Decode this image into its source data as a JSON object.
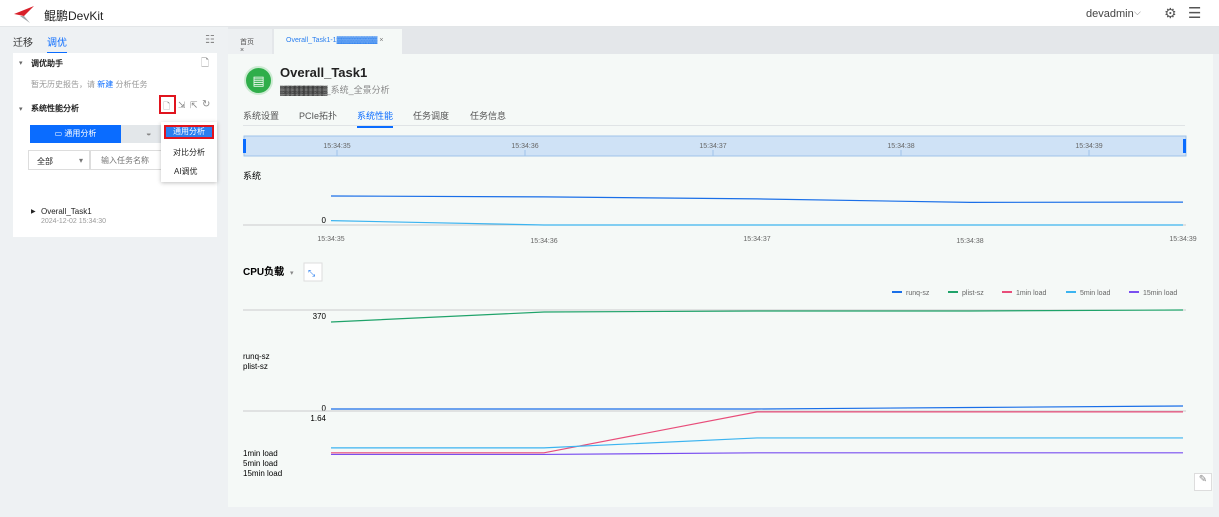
{
  "app": {
    "title": "鲲鹏DevKit",
    "user": "devadmin"
  },
  "left": {
    "tabs": [
      {
        "label": "迁移",
        "active": false
      },
      {
        "label": "调优",
        "active": true
      }
    ],
    "assistant": {
      "title": "调优助手",
      "empty_prefix": "暂无历史报告，请",
      "empty_link": "新建",
      "empty_suffix": "分析任务"
    },
    "perf": {
      "title": "系统性能分析",
      "mode_button": "通用分析",
      "filter_select": "全部",
      "search_placeholder": "输入任务名称",
      "tasks": [
        {
          "name": "Overall_Task1",
          "time": "2024-12-02 15:34:30"
        }
      ]
    },
    "dropdown": [
      "通用分析",
      "对比分析",
      "AI调优"
    ]
  },
  "tabs": [
    {
      "label": "首页"
    },
    {
      "label": "Overall_Task1-1▓▓▓▓▓▓▓▓",
      "active": true
    }
  ],
  "task": {
    "name": "Overall_Task1",
    "subtitle_redacted": "▓▓▓▓▓▓▓▓▓▓",
    "subtitle": "_系统_全景分析",
    "subtabs": [
      {
        "label": "系统设置"
      },
      {
        "label": "PCIe拓扑"
      },
      {
        "label": "系统性能",
        "active": true
      },
      {
        "label": "任务调度"
      },
      {
        "label": "任务信息"
      }
    ]
  },
  "timeline": {
    "ticks": [
      "15:34:35",
      "15:34:36",
      "15:34:37",
      "15:34:38",
      "15:34:39"
    ]
  },
  "colors": {
    "accent": "#0a6cff",
    "runq": "#1a6fe8",
    "plist": "#1fa36a",
    "load1": "#e84d7a",
    "load5": "#3cb4f0",
    "load15": "#7a4ff0"
  },
  "chart_data": [
    {
      "type": "line",
      "title": "系统",
      "x": [
        "15:34:35",
        "15:34:36",
        "15:34:37",
        "15:34:38",
        "15:34:39"
      ],
      "y_tick": "0",
      "series": [
        {
          "values": [
            1.0,
            0.97,
            0.9,
            0.78,
            0.79
          ]
        },
        {
          "values": [
            0.15,
            0.0,
            0.0,
            0.0,
            0.0
          ]
        }
      ]
    },
    {
      "type": "line",
      "title": "CPU负载",
      "legend_position": "top-right",
      "x": [
        "15:34:35",
        "15:34:36",
        "15:34:37",
        "15:34:38",
        "15:34:39"
      ],
      "panels": [
        {
          "labels": [
            "runq-sz",
            "plist-sz"
          ],
          "y_ticks": [
            "370",
            "0"
          ],
          "series": [
            {
              "name": "runq-sz",
              "values": [
                0,
                0,
                0,
                0.5,
                1
              ]
            },
            {
              "name": "plist-sz",
              "values": [
                370,
                380,
                381,
                381,
                382
              ]
            }
          ]
        },
        {
          "labels": [
            "1min load",
            "5min load",
            "15min load"
          ],
          "y_ticks": [
            "1.64"
          ],
          "series": [
            {
              "name": "1min load",
              "values": [
                0.4,
                0.4,
                1.64,
                1.64,
                1.64
              ]
            },
            {
              "name": "5min load",
              "values": [
                0.55,
                0.55,
                0.85,
                0.85,
                0.85
              ]
            },
            {
              "name": "15min load",
              "values": [
                0.35,
                0.35,
                0.4,
                0.4,
                0.4
              ]
            }
          ]
        }
      ]
    }
  ]
}
